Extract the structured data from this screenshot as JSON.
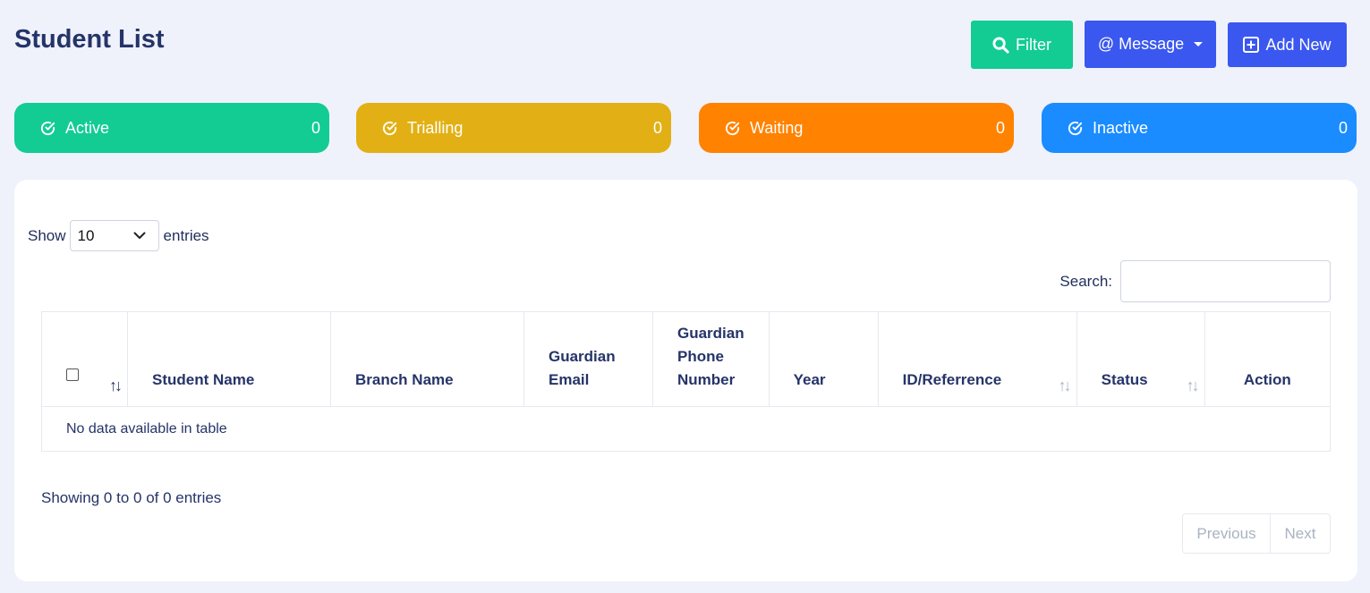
{
  "header": {
    "title": "Student List",
    "filter_label": "Filter",
    "message_label": "@ Message",
    "add_label": "Add New"
  },
  "stats": [
    {
      "label": "Active",
      "count": "0",
      "color": "#12cc94"
    },
    {
      "label": "Trialling",
      "count": "0",
      "color": "#e2b014"
    },
    {
      "label": "Waiting",
      "count": "0",
      "color": "#ff8200"
    },
    {
      "label": "Inactive",
      "count": "0",
      "color": "#1a8cff"
    }
  ],
  "table_controls": {
    "show_label": "Show",
    "page_size": "10",
    "entries_label": "entries",
    "search_label": "Search:",
    "search_value": ""
  },
  "table": {
    "columns": [
      "Student Name",
      "Branch Name",
      "Guardian Email",
      "Guardian Phone Number",
      "Year",
      "ID/Referrence",
      "Status",
      "Action"
    ],
    "empty_message": "No data available in table"
  },
  "footer": {
    "info": "Showing 0 to 0 of 0 entries",
    "previous_label": "Previous",
    "next_label": "Next"
  },
  "icons": {
    "filter": "search-icon",
    "add": "plus-square-icon",
    "stat": "check-circle-icon",
    "sort": "sort-icon",
    "select_caret": "chevron-down-icon"
  }
}
